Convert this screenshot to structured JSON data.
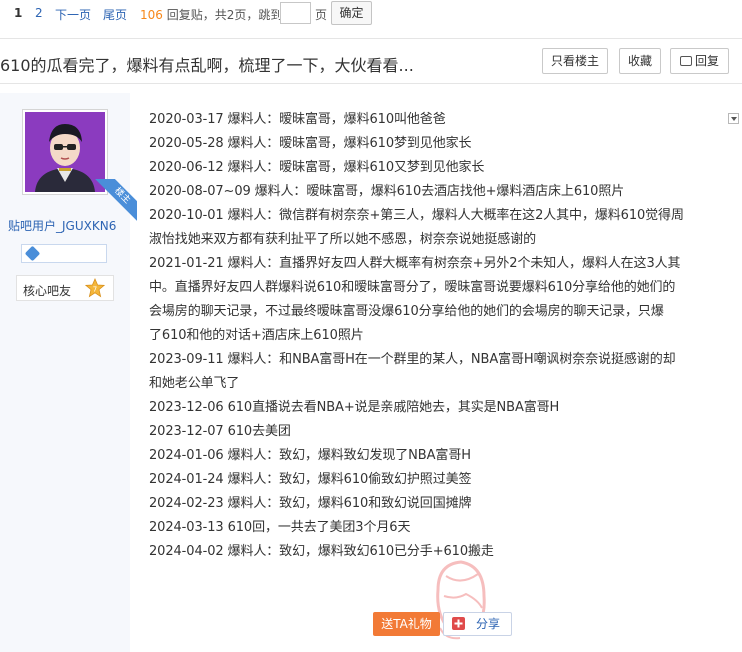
{
  "pager": {
    "current": "1",
    "page2": "2",
    "next": "下一页",
    "last": "尾页",
    "reply_count": "106",
    "reply_label": "回复贴，共",
    "total_pages": "2",
    "pages_label": "页，跳到",
    "unit": "页",
    "confirm": "确定"
  },
  "thread": {
    "title": "610的瓜看完了，爆料有点乱啊，梳理了一下，大伙看看...",
    "only_op": "只看楼主",
    "favorite": "收藏",
    "reply": "回复"
  },
  "user": {
    "badge": "楼主",
    "name": "贴吧用户_JGUXKN6",
    "fan_label": "核心吧友",
    "fan_level": "7"
  },
  "post": {
    "lines": [
      "2020-03-17 爆料人：暧昧富哥，爆料610叫他爸爸",
      "2020-05-28 爆料人：暧昧富哥，爆料610梦到见他家长",
      "2020-06-12 爆料人：暧昧富哥，爆料610又梦到见他家长",
      "2020-08-07~09 爆料人：暧昧富哥，爆料610去酒店找他+爆料酒店床上610照片",
      "2020-10-01 爆料人：微信群有树奈奈+第三人，爆料人大概率在这2人其中，爆料610觉得周",
      "淑怡找她来双方都有获利扯平了所以她不感恩，树奈奈说她挺感谢的",
      "2021-01-21 爆料人：直播界好友四人群大概率有树奈奈+另外2个未知人，爆料人在这3人其",
      "中。直播界好友四人群爆料说610和暧昧富哥分了，暧昧富哥说要爆料610分享给他的她们的",
      "会場房的聊天记录，不过最终暧昧富哥没爆610分享给他的她们的会場房的聊天记录，只爆",
      "了610和他的对话+酒店床上610照片",
      "2023-09-11 爆料人：和NBA富哥H在一个群里的某人，NBA富哥H嘲讽树奈奈说挺感谢的却",
      "和她老公单飞了",
      "2023-12-06 610直播说去看NBA+说是亲戚陪她去，其实是NBA富哥H",
      "2023-12-07 610去美团",
      "2024-01-06 爆料人：致幻，爆料致幻发现了NBA富哥H",
      "2024-01-24 爆料人：致幻，爆料610偷致幻护照过美签",
      "2024-02-23 爆料人：致幻，爆料610和致幻说回国摊牌",
      "2024-03-13 610回，一共去了美团3个月6天",
      "2024-04-02 爆料人：致幻，爆料致幻610已分手+610搬走"
    ]
  },
  "actions": {
    "gift": "送TA礼物",
    "share": "分享"
  },
  "colors": {
    "link": "#2d64b3",
    "accent_orange": "#f7881a",
    "gift_orange": "#f27a36",
    "badge_blue": "#4a8ed9",
    "sidebar_bg": "#f6f8fc"
  }
}
